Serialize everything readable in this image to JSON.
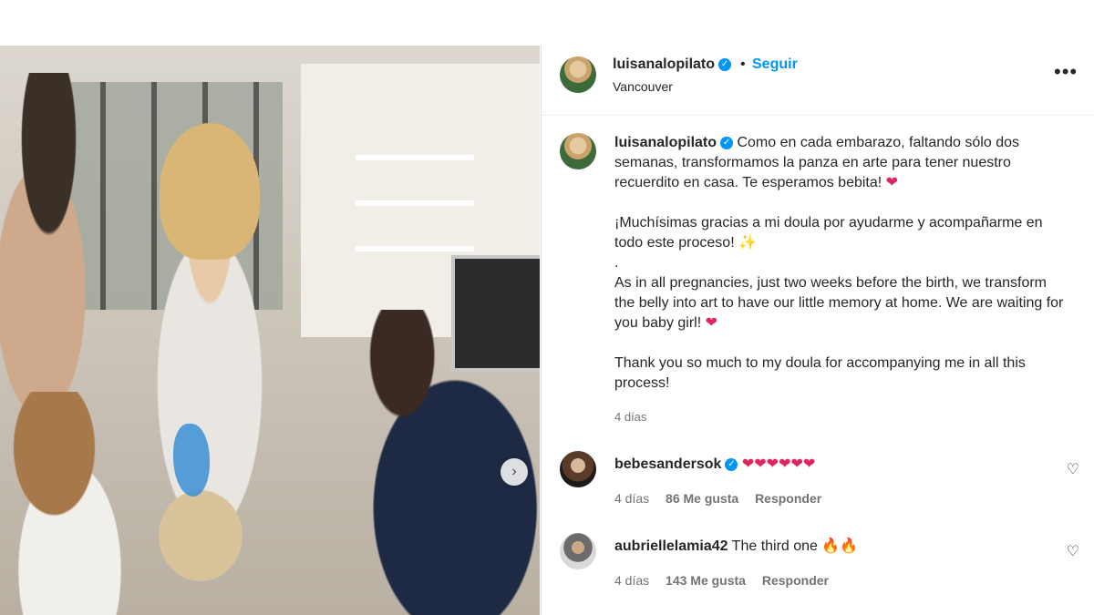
{
  "header": {
    "username": "luisanalopilato",
    "separator": "•",
    "follow_label": "Seguir",
    "location": "Vancouver",
    "more_icon": "more-horizontal-icon"
  },
  "caption": {
    "username": "luisanalopilato",
    "p1": "Como en cada embarazo, faltando sólo dos semanas, transformamos la panza en arte para tener nuestro recuerdito en casa. Te esperamos bebita!",
    "p2": "¡Muchísimas gracias a mi doula por ayudarme y acompañarme en todo este proceso!",
    "p3": ".",
    "p4": "As in all pregnancies, just two weeks before the birth, we transform the belly into art to have our little memory at home. We are waiting for you baby girl!",
    "p5": "Thank you so much to my doula for accompanying me in all this process!",
    "time": "4 días"
  },
  "comments": [
    {
      "username": "bebesandersok",
      "text": "",
      "time": "4 días",
      "likes": "86 Me gusta",
      "reply": "Responder"
    },
    {
      "username": "aubriellelamia42",
      "text": "The third one",
      "time": "4 días",
      "likes": "143 Me gusta",
      "reply": "Responder"
    }
  ],
  "emoji": {
    "heart": "❤",
    "sparkles": "✨",
    "fire": "🔥",
    "hearts_six": "❤❤❤❤❤❤",
    "fire_two": "🔥🔥"
  },
  "carousel": {
    "next_icon": "chevron-right-icon",
    "next_glyph": "›"
  },
  "colors": {
    "accent": "#0095f6",
    "muted": "#737373",
    "text": "#262626"
  }
}
